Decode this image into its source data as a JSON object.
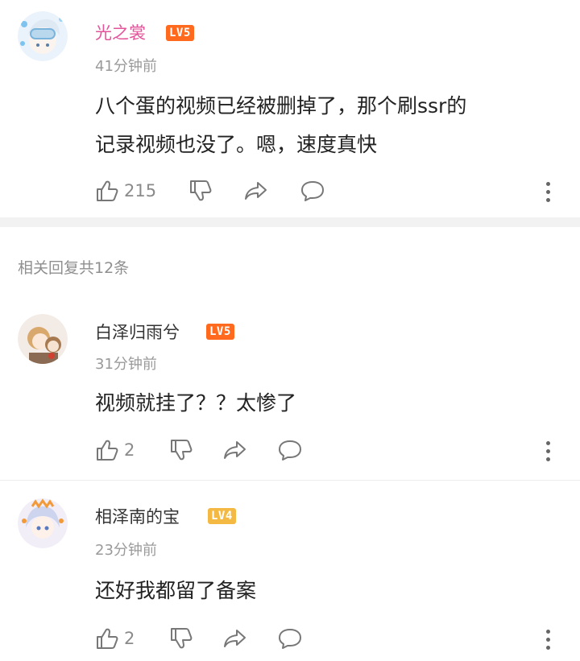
{
  "main_comment": {
    "username": "光之裳",
    "level": "LV5",
    "time": "41分钟前",
    "content_line1": "八个蛋的视频已经被删掉了，那个刷ssr的",
    "content_line2": "记录视频也没了。嗯，速度真快",
    "likes": "215"
  },
  "replies_header": "相关回复共12条",
  "replies": [
    {
      "username": "白泽归雨兮",
      "level": "LV5",
      "time": "31分钟前",
      "content": "视频就挂了？？太惨了",
      "likes": "2"
    },
    {
      "username": "相泽南的宝",
      "level": "LV4",
      "time": "23分钟前",
      "content": "还好我都留了备案",
      "likes": "2"
    }
  ],
  "colors": {
    "vip_name": "#e4549a",
    "level_badge": "#ff6a1f",
    "level_badge_light": "#f4b942"
  },
  "icons": [
    "like-icon",
    "dislike-icon",
    "share-icon",
    "reply-icon",
    "more-icon"
  ]
}
